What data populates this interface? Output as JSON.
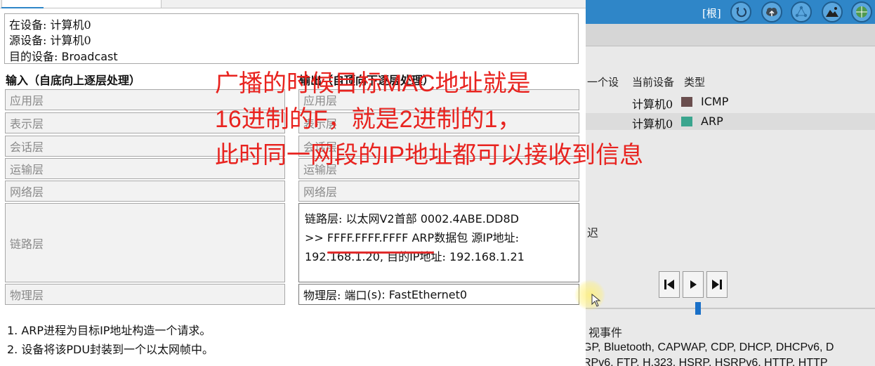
{
  "pdu_dialog": {
    "device_info": {
      "at_device_label": "在设备:",
      "at_device_value": "计算机0",
      "source_label": "源设备:",
      "source_value": "计算机0",
      "dest_label": "目的设备:",
      "dest_value": "Broadcast"
    },
    "in_layers_header": "输入（自底向上逐层处理）",
    "out_layers_header": "输出（自顶向下逐层处理）",
    "in_layers": [
      "应用层",
      "表示层",
      "会话层",
      "运输层",
      "网络层",
      "链路层",
      "物理层"
    ],
    "out_layers": [
      "应用层",
      "表示层",
      "会话层",
      "运输层",
      "网络层"
    ],
    "out_link_layer": {
      "line1_label": "链路层: 以太网",
      "line1_version": "V2",
      "line1_header": "首部",
      "line1_mac": "0002.4ABE.DD8D",
      "line2_prefix": ">>",
      "line2_mac": "FFFF.FFFF.FFFF",
      "line2_proto": "ARP",
      "line2_packet": "数据包 源",
      "line2_ip_label": "IP",
      "line2_addr_label": "地址:",
      "line3_src_ip": "192.168.1.20,",
      "line3_dst_label": "目的",
      "line3_ip_label": "IP",
      "line3_addr_label": "地址:",
      "line3_dst_ip": "192.168.1.21"
    },
    "out_physical_layer": {
      "label": "物理层: 端口",
      "ports": "(s): FastEthernet0"
    },
    "descriptions": [
      "1. ARP进程为目标IP地址构造一个请求。",
      "2. 设备将该PDU封装到一个以太网帧中。"
    ]
  },
  "annotation": {
    "line1": "广播的时候目标MAC地址就是",
    "line2": "16进制的F，就是2进制的1，",
    "line3": "此时同一网段的IP地址都可以接收到信息",
    "color": "#e8231f"
  },
  "right_panel": {
    "toolbar": {
      "root_label": "[根]",
      "buttons": [
        "back-icon",
        "cloud-upload-icon",
        "network-cluster-icon",
        "mountain-image-icon",
        "globe-icon"
      ]
    },
    "event_list": {
      "col_last_device": "一个设",
      "col_current_device": "当前设备",
      "col_type": "类型",
      "rows": [
        {
          "device": "计算机0",
          "type": "ICMP",
          "color": "#6a4e4e"
        },
        {
          "device": "计算机0",
          "type": "ARP",
          "color": "#3aa58e"
        }
      ]
    },
    "delay_label": "迟",
    "filter_title": "视事件",
    "filter_line1": "GP, Bluetooth, CAPWAP, CDP, DHCP, DHCPv6, D",
    "filter_line2": "RPv6, FTP, H.323, HSRP, HSRPv6, HTTP, HTTP"
  },
  "colors": {
    "toolbar_blue": "#2f86c8",
    "underline_red": "#e02b2b",
    "slider_blue": "#1a70c8"
  }
}
